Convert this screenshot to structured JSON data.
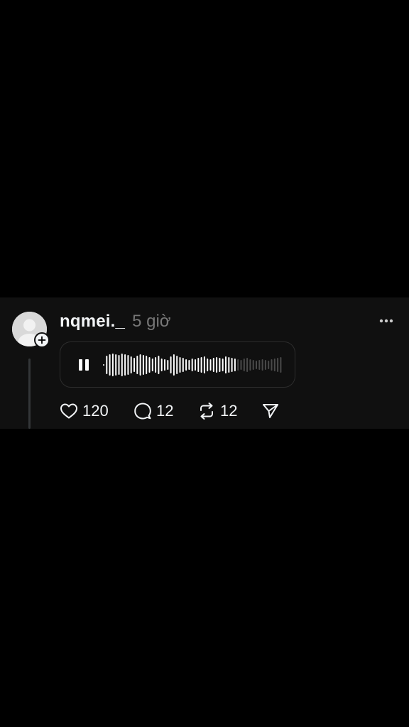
{
  "post": {
    "username": "nqmei._",
    "timestamp": "5 giờ",
    "avatar": {
      "icon": "default-avatar-icon",
      "badge_icon": "plus-icon"
    },
    "menu_icon": "more-dots-icon",
    "audio": {
      "state": "playing",
      "control_icon": "pause-icon",
      "progress_fraction": 0.73
    },
    "actions": {
      "likes": "120",
      "comments": "12",
      "reposts": "12",
      "like_icon": "heart-icon",
      "comment_icon": "comment-bubble-icon",
      "repost_icon": "repost-icon",
      "share_icon": "send-icon"
    }
  },
  "colors": {
    "background": "#000000",
    "card": "#101010",
    "text_primary": "#f3f5f7",
    "text_secondary": "#777777",
    "wave_played": "#ffffff",
    "wave_unplayed": "#4a4a4a"
  }
}
